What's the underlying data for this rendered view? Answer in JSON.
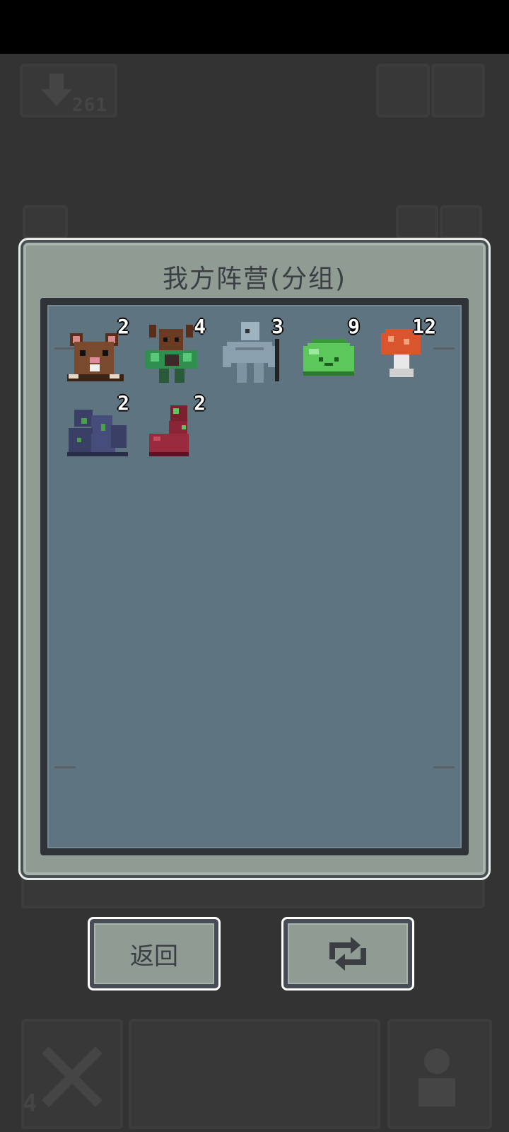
{
  "app": {
    "background": "#333333"
  },
  "background_hud": {
    "currency_count": "261",
    "level_badge": "4"
  },
  "dialog": {
    "title": "我方阵营(分组)",
    "units": [
      {
        "name": "rat",
        "icon": "rat-icon",
        "count": "2"
      },
      {
        "name": "minotaur",
        "icon": "minotaur-icon",
        "count": "4"
      },
      {
        "name": "golem",
        "icon": "stone-golem-icon",
        "count": "3"
      },
      {
        "name": "slime",
        "icon": "green-slime-icon",
        "count": "9"
      },
      {
        "name": "mushroom",
        "icon": "mushroom-icon",
        "count": "12"
      },
      {
        "name": "blob",
        "icon": "dark-blob-icon",
        "count": "2"
      },
      {
        "name": "worm",
        "icon": "red-worm-icon",
        "count": "2"
      }
    ]
  },
  "buttons": {
    "back_label": "返回",
    "swap_icon": "swap-arrows-icon"
  },
  "colors": {
    "panel": "#8f9b93",
    "roster_bg": "#5e7581",
    "frame_dark": "#2f3338",
    "count_text": "#ffffff"
  }
}
